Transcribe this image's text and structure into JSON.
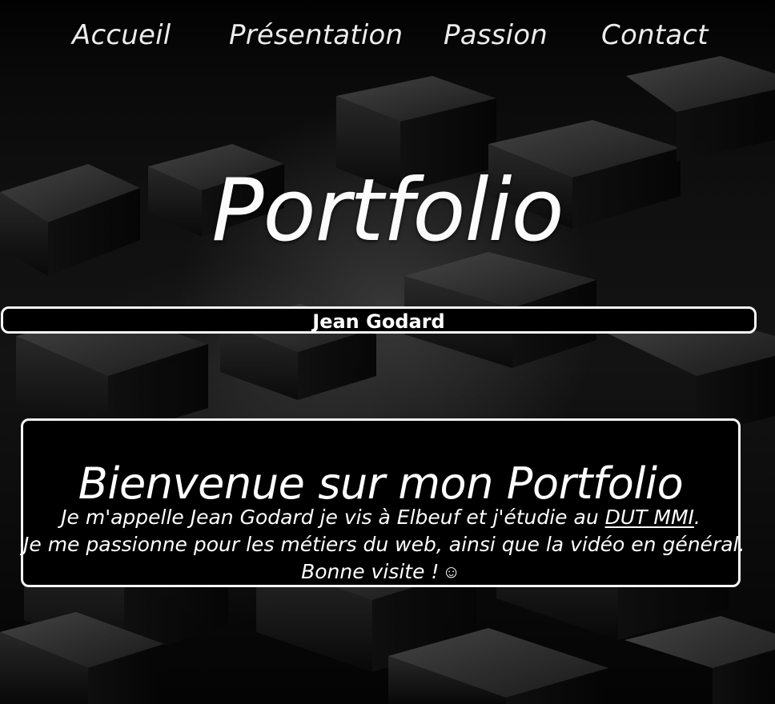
{
  "nav": {
    "items": [
      {
        "label": "Accueil"
      },
      {
        "label": "Présentation"
      },
      {
        "label": "Passion"
      },
      {
        "label": "Contact"
      }
    ]
  },
  "hero": {
    "title": "Portfolio"
  },
  "profile": {
    "name": "Jean Godard"
  },
  "welcome": {
    "title": "Bienvenue sur mon Portfolio",
    "line_1_prefix": "Je m'appelle Jean Godard je vis à Elbeuf et j'étudie au ",
    "link_label": "DUT MMI",
    "line_1_suffix": ".",
    "line_2": "Je me passionne pour les métiers du web, ainsi que la vidéo en général.",
    "line_3": "Bonne visite !",
    "smile": "☺"
  },
  "colors": {
    "background": "#000000",
    "text": "#ffffff",
    "border": "#f5f5f5"
  }
}
